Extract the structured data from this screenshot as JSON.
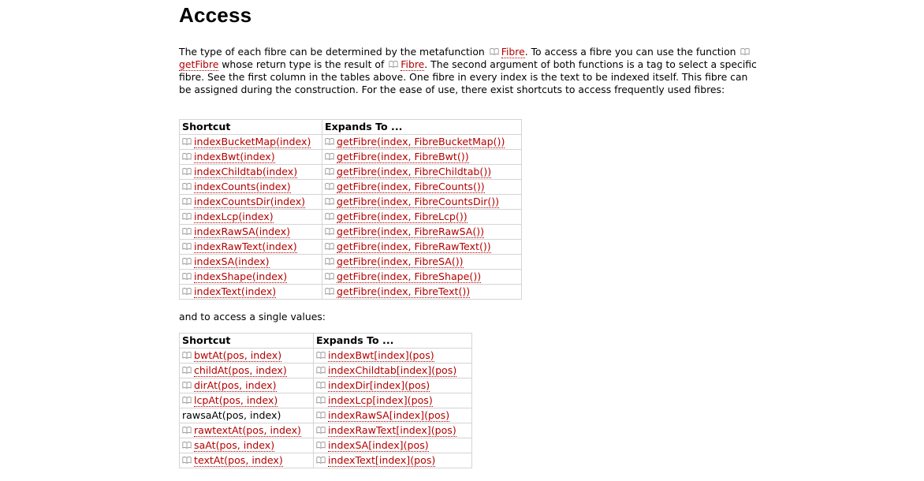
{
  "title": "Access",
  "intro": {
    "t1": "The type of each fibre can be determined by the metafunction ",
    "l1": "Fibre",
    "t2": ". To access a fibre you can use the function ",
    "l2": "getFibre",
    "t3": " whose return type is the result of ",
    "l3": "Fibre",
    "t4": ". The second argument of both functions is a tag to select a specific fibre. See the first column in the tables above. One fibre in every index is the text to be indexed itself. This fibre can be assigned during the construction. For the ease of use, there exist shortcuts to access frequently used fibres:"
  },
  "table1": {
    "headers": [
      "Shortcut",
      "Expands To ..."
    ],
    "rows": [
      [
        "indexBucketMap(index)",
        "getFibre(index, FibreBucketMap())"
      ],
      [
        "indexBwt(index)",
        "getFibre(index, FibreBwt())"
      ],
      [
        "indexChildtab(index)",
        "getFibre(index, FibreChildtab())"
      ],
      [
        "indexCounts(index)",
        "getFibre(index, FibreCounts())"
      ],
      [
        "indexCountsDir(index)",
        "getFibre(index, FibreCountsDir())"
      ],
      [
        "indexLcp(index)",
        "getFibre(index, FibreLcp())"
      ],
      [
        "indexRawSA(index)",
        "getFibre(index, FibreRawSA())"
      ],
      [
        "indexRawText(index)",
        "getFibre(index, FibreRawText())"
      ],
      [
        "indexSA(index)",
        "getFibre(index, FibreSA())"
      ],
      [
        "indexShape(index)",
        "getFibre(index, FibreShape())"
      ],
      [
        "indexText(index)",
        "getFibre(index, FibreText())"
      ]
    ]
  },
  "between_text": "and to access a single values:",
  "table2": {
    "headers": [
      "Shortcut",
      "Expands To ..."
    ],
    "rows": [
      [
        "bwtAt(pos, index)",
        "indexBwt[index](pos)"
      ],
      [
        "childAt(pos, index)",
        "indexChildtab[index](pos)"
      ],
      [
        "dirAt(pos, index)",
        "indexDir[index](pos)"
      ],
      [
        "lcpAt(pos, index)",
        "indexLcp[index](pos)"
      ],
      [
        "rawsaAt(pos, index)",
        "indexRawSA[index](pos)"
      ],
      [
        "rawtextAt(pos, index)",
        "indexRawText[index](pos)"
      ],
      [
        "saAt(pos, index)",
        "indexSA[index](pos)"
      ],
      [
        "textAt(pos, index)",
        "indexText[index](pos)"
      ]
    ],
    "unlinked_rows": [
      4
    ]
  }
}
